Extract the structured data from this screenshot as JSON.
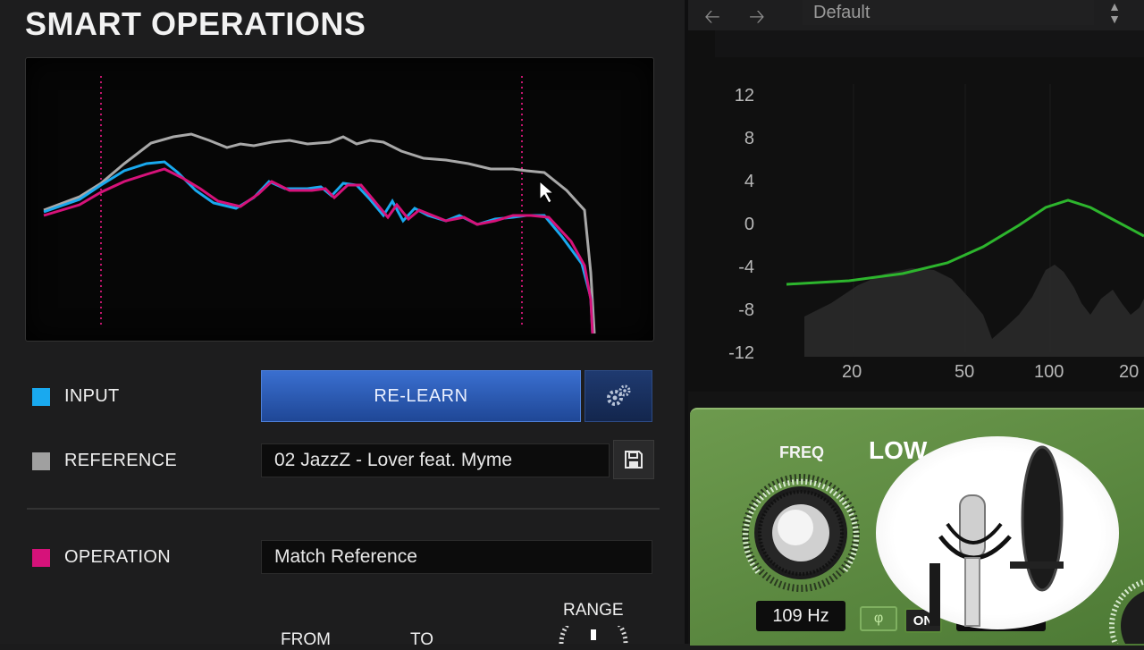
{
  "left_panel": {
    "title": "SMART OPERATIONS",
    "rows": {
      "input": {
        "label": "INPUT",
        "color": "#19a9ef"
      },
      "reference": {
        "label": "REFERENCE",
        "color": "#a0a0a0"
      },
      "operation": {
        "label": "OPERATION",
        "color": "#d6127a"
      }
    },
    "relearn_label": "RE-LEARN",
    "settings_icon": "gears-icon",
    "reference_track": "02 JazzZ - Lover feat. Myme",
    "save_icon": "floppy-disk-icon",
    "operation_value": "Match Reference",
    "range_label": "RANGE",
    "from_label": "FROM",
    "to_label": "TO"
  },
  "right_panel": {
    "preset": "Default",
    "back_icon": "arrow-left-icon",
    "forward_icon": "arrow-right-icon",
    "eq_y_labels": [
      "12",
      "8",
      "4",
      "0",
      "-4",
      "-8",
      "-12"
    ],
    "eq_x_labels": [
      "20",
      "50",
      "100",
      "20"
    ],
    "band": {
      "freq_label": "FREQ",
      "type_label": "LOW",
      "freq_value": "109 Hz",
      "phase_icon": "phase-icon",
      "on_label": "ON"
    }
  },
  "colors": {
    "accent_blue": "#2c5fbf",
    "eq_green": "#2db52d",
    "panel_green": "#5e8c42"
  }
}
